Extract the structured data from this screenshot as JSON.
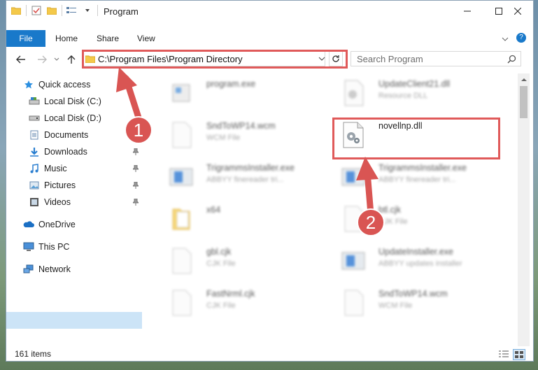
{
  "window": {
    "title": "Program"
  },
  "ribbon": {
    "tabs": [
      "File",
      "Home",
      "Share",
      "View"
    ]
  },
  "address": {
    "path": "C:\\Program Files\\Program Directory"
  },
  "search": {
    "placeholder": "Search Program"
  },
  "nav": {
    "items": [
      {
        "label": "Quick access",
        "icon": "star-icon"
      },
      {
        "label": "Local Disk (C:)",
        "icon": "drive-icon"
      },
      {
        "label": "Local Disk (D:)",
        "icon": "drive-icon"
      },
      {
        "label": "Documents",
        "icon": "documents-icon"
      },
      {
        "label": "Downloads",
        "icon": "download-icon"
      },
      {
        "label": "Music",
        "icon": "music-icon"
      },
      {
        "label": "Pictures",
        "icon": "pictures-icon"
      },
      {
        "label": "Videos",
        "icon": "videos-icon"
      },
      {
        "label": "OneDrive",
        "icon": "cloud-icon"
      },
      {
        "label": "This PC",
        "icon": "computer-icon"
      },
      {
        "label": "Network",
        "icon": "network-icon"
      }
    ]
  },
  "files": [
    {
      "name": "program.exe",
      "type": "",
      "icon": "exe-icon"
    },
    {
      "name": "UpdateClient21.dll",
      "type": "Resource DLL",
      "icon": "dll-icon"
    },
    {
      "name": "SndToWP14.wcm",
      "type": "WCM File",
      "icon": "document-icon"
    },
    {
      "name": "novellnp.dll",
      "type": "",
      "icon": "dll-icon"
    },
    {
      "name": "TrigrammsInstaller.exe",
      "type": "ABBYY finereader tri...",
      "icon": "installer-icon"
    },
    {
      "name": "TrigrammsInstaller.exe",
      "type": "ABBYY finereader tri...",
      "icon": "installer-icon"
    },
    {
      "name": "x64",
      "type": "",
      "icon": "folder-icon"
    },
    {
      "name": "btl.cjk",
      "type": "CJK File",
      "icon": "document-icon"
    },
    {
      "name": "gbl.cjk",
      "type": "CJK File",
      "icon": "document-icon"
    },
    {
      "name": "UpdateInstaller.exe",
      "type": "ABBYY updates installer",
      "icon": "installer-icon"
    },
    {
      "name": "FastNrml.cjk",
      "type": "CJK File",
      "icon": "document-icon"
    },
    {
      "name": "SndToWP14.wcm",
      "type": "WCM File",
      "icon": "document-icon"
    }
  ],
  "status": {
    "count": "161 items"
  },
  "annotations": {
    "step1": "1",
    "step2": "2",
    "color": "#d95553"
  }
}
